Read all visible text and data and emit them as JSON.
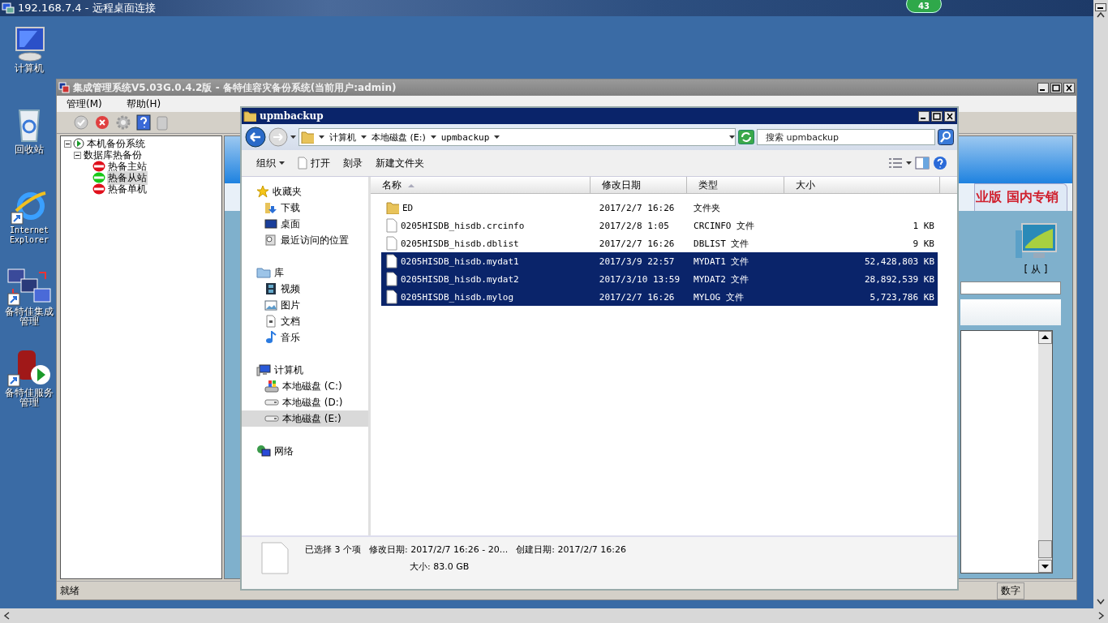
{
  "remote_session": {
    "title": "192.168.7.4 - 远程桌面连接",
    "badge": "43"
  },
  "desktop_icons": [
    {
      "label": "计算机",
      "kind": "computer"
    },
    {
      "label": "回收站",
      "kind": "recycle"
    },
    {
      "label": "Internet Explorer",
      "kind": "browser"
    },
    {
      "label": "备特佳集成管理",
      "kind": "suite"
    },
    {
      "label": "备特佳服务管理",
      "kind": "service"
    }
  ],
  "backup_window": {
    "title": "集成管理系统V5.03G.0.4.2版  - 备特佳容灾备份系统(当前用户:admin)",
    "menu": [
      "管理(M)",
      "帮助(H)"
    ],
    "tree": [
      {
        "label": "本机备份系统",
        "kind": "system",
        "expanded": true,
        "selected": false,
        "children": [
          {
            "label": "数据库热备份",
            "expanded": true,
            "selected": false,
            "children": [
              {
                "label": "热备主站",
                "kind": "node",
                "color": "#e0101c",
                "selected": false
              },
              {
                "label": "热备从站",
                "kind": "node",
                "color": "#18c818",
                "selected": true
              },
              {
                "label": "热备单机",
                "kind": "node",
                "color": "#e0101c",
                "selected": false
              }
            ]
          }
        ]
      }
    ],
    "banner_tab": "业版 国内专销",
    "host_role": "[ 从 ]",
    "status_bar": {
      "left": "就绪",
      "right": "数字"
    }
  },
  "explorer": {
    "title": "upmbackup",
    "breadcrumb": [
      "计算机",
      "本地磁盘 (E:)",
      "upmbackup"
    ],
    "search": {
      "placeholder": "搜索 upmbackup"
    },
    "toolbar": [
      {
        "label": "组织",
        "kind": "menu"
      },
      {
        "label": "打开",
        "kind": "open"
      },
      {
        "label": "刻录",
        "kind": "plain"
      },
      {
        "label": "新建文件夹",
        "kind": "plain"
      }
    ],
    "nav": [
      {
        "label": "收藏夹",
        "kind": "favorites",
        "selected": false,
        "children": [
          {
            "label": "下载",
            "kind": "download",
            "selected": false
          },
          {
            "label": "桌面",
            "kind": "desktop",
            "selected": false
          },
          {
            "label": "最近访问的位置",
            "kind": "recent",
            "selected": false
          }
        ]
      },
      {
        "label": "库",
        "kind": "library",
        "selected": false,
        "children": [
          {
            "label": "视频",
            "kind": "video",
            "selected": false
          },
          {
            "label": "图片",
            "kind": "pictures",
            "selected": false
          },
          {
            "label": "文档",
            "kind": "documents",
            "selected": false
          },
          {
            "label": "音乐",
            "kind": "music",
            "selected": false
          }
        ]
      },
      {
        "label": "计算机",
        "kind": "computer",
        "selected": false,
        "children": [
          {
            "label": "本地磁盘 (C:)",
            "kind": "system-drive",
            "selected": false
          },
          {
            "label": "本地磁盘 (D:)",
            "kind": "drive",
            "selected": false
          },
          {
            "label": "本地磁盘 (E:)",
            "kind": "drive",
            "selected": true
          }
        ]
      },
      {
        "label": "网络",
        "kind": "network",
        "selected": false
      }
    ],
    "columns": [
      "名称",
      "修改日期",
      "类型",
      "大小"
    ],
    "files": [
      {
        "name": "ED",
        "modified": "2017/2/7 16:26",
        "type": "文件夹",
        "kind": "folder",
        "selected": false
      },
      {
        "name": "0205HISDB_hisdb.crcinfo",
        "modified": "2017/2/8 1:05",
        "type": "CRCINFO 文件",
        "size": "1 KB",
        "kind": "file",
        "selected": false
      },
      {
        "name": "0205HISDB_hisdb.dblist",
        "modified": "2017/2/7 16:26",
        "type": "DBLIST 文件",
        "size": "9 KB",
        "kind": "file",
        "selected": false
      },
      {
        "name": "0205HISDB_hisdb.mydat1",
        "modified": "2017/3/9 22:57",
        "type": "MYDAT1 文件",
        "size": "52,428,803 KB",
        "kind": "file",
        "selected": true
      },
      {
        "name": "0205HISDB_hisdb.mydat2",
        "modified": "2017/3/10 13:59",
        "type": "MYDAT2 文件",
        "size": "28,892,539 KB",
        "kind": "file",
        "selected": true
      },
      {
        "name": "0205HISDB_hisdb.mylog",
        "modified": "2017/2/7 16:26",
        "type": "MYLOG 文件",
        "size": "5,723,786 KB",
        "kind": "file",
        "selected": true
      }
    ],
    "details": {
      "summary": "已选择 3 个项",
      "modified": "修改日期: 2017/2/7 16:26 - 20...",
      "created": "创建日期: 2017/2/7 16:26",
      "size": "大小: 83.0 GB"
    }
  }
}
